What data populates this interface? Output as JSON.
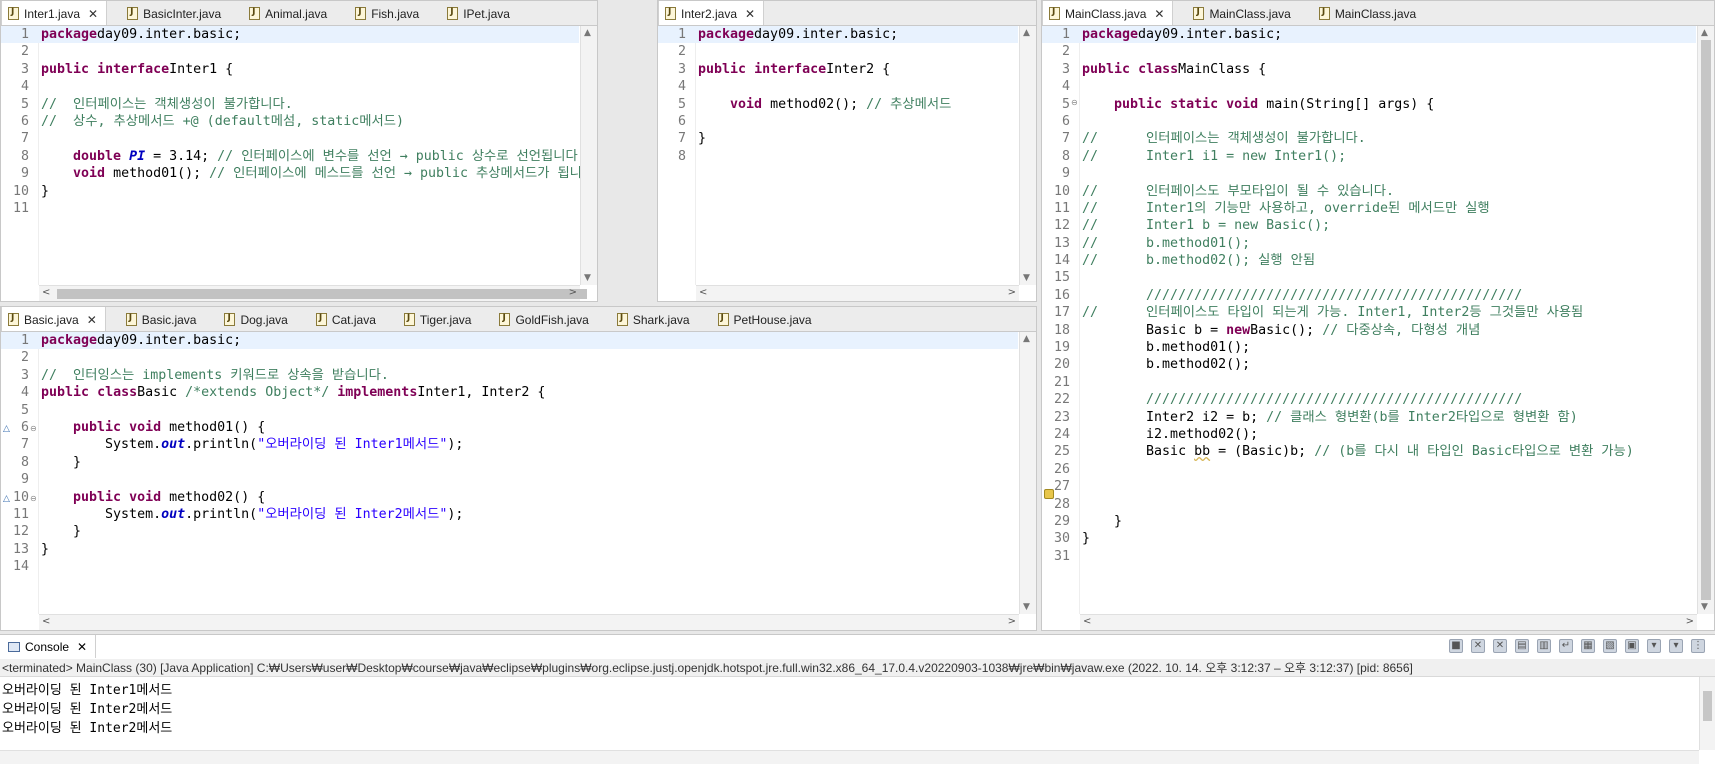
{
  "inter1_pane": {
    "tabs": [
      "Inter1.java",
      "BasicInter.java",
      "Animal.java",
      "Fish.java",
      "IPet.java"
    ],
    "lines": [
      [
        [
          "kw",
          "package"
        ],
        [
          "",
          "day09.inter.basic;"
        ]
      ],
      [],
      [
        [
          "kw",
          "public"
        ],
        [
          "",
          ""
        ],
        [
          "kw",
          "interface"
        ],
        [
          "",
          "Inter1 {"
        ]
      ],
      [],
      [
        [
          "cm",
          "//  인터페이스는 객체생성이 불가합니다."
        ]
      ],
      [
        [
          "cm",
          "//  상수, 추상메서드 +@ (default메섬, static메서드)"
        ]
      ],
      [],
      [
        [
          "",
          "    "
        ],
        [
          "kw",
          "double"
        ],
        [
          "",
          ""
        ],
        [
          "fld",
          "PI"
        ],
        [
          "",
          ""
        ],
        [
          "",
          "= 3.14; "
        ],
        [
          "cm",
          "// 인터페이스에 변수를 선언 → public 상수로 선언됩니다."
        ]
      ],
      [
        [
          "",
          "    "
        ],
        [
          "kw",
          "void"
        ],
        [
          "",
          ""
        ],
        [
          "",
          "method01(); "
        ],
        [
          "cm",
          "// 인터페이스에 메스드를 선언 → public 추상메서드가 됩니다"
        ]
      ],
      [
        [
          "",
          "}"
        ]
      ],
      []
    ]
  },
  "inter2_pane": {
    "tabs": [
      "Inter2.java"
    ],
    "lines": [
      [
        [
          "kw",
          "package"
        ],
        [
          "",
          "day09.inter.basic;"
        ]
      ],
      [],
      [
        [
          "kw",
          "public"
        ],
        [
          "",
          ""
        ],
        [
          "kw",
          "interface"
        ],
        [
          "",
          "Inter2 {"
        ]
      ],
      [],
      [
        [
          "",
          "    "
        ],
        [
          "kw",
          "void"
        ],
        [
          "",
          ""
        ],
        [
          "",
          "method02(); "
        ],
        [
          "cm",
          "// 추상메서드"
        ]
      ],
      [],
      [
        [
          "",
          "}"
        ]
      ],
      []
    ]
  },
  "basic_pane": {
    "tabs": [
      "Basic.java",
      "Basic.java",
      "Dog.java",
      "Cat.java",
      "Tiger.java",
      "GoldFish.java",
      "Shark.java",
      "PetHouse.java"
    ],
    "lines": [
      [
        [
          "kw",
          "package"
        ],
        [
          "",
          "day09.inter.basic;"
        ]
      ],
      [],
      [
        [
          "cm",
          "//  인터잉스는 implements 키워드로 상속을 받습니다."
        ]
      ],
      [
        [
          "kw",
          "public"
        ],
        [
          "",
          ""
        ],
        [
          "kw",
          "class"
        ],
        [
          "",
          "Basic "
        ],
        [
          "cm",
          "/*extends Object*/"
        ],
        [
          "",
          ""
        ],
        [
          "kw",
          "implements"
        ],
        [
          "",
          "Inter1, Inter2 {"
        ]
      ],
      [],
      [
        [
          "",
          "    "
        ],
        [
          "kw",
          "public"
        ],
        [
          "",
          ""
        ],
        [
          "kw",
          "void"
        ],
        [
          "",
          ""
        ],
        [
          "",
          "method01() {"
        ]
      ],
      [
        [
          "",
          "        System."
        ],
        [
          "fld",
          "out"
        ],
        [
          "",
          ".println("
        ],
        [
          "str",
          "\"오버라이딩 된 Inter1메서드\""
        ],
        [
          "",
          ");"
        ]
      ],
      [
        [
          "",
          "    }"
        ]
      ],
      [],
      [
        [
          "",
          "    "
        ],
        [
          "kw",
          "public"
        ],
        [
          "",
          ""
        ],
        [
          "kw",
          "void"
        ],
        [
          "",
          ""
        ],
        [
          "",
          "method02() {"
        ]
      ],
      [
        [
          "",
          "        System."
        ],
        [
          "fld",
          "out"
        ],
        [
          "",
          ".println("
        ],
        [
          "str",
          "\"오버라이딩 된 Inter2메서드\""
        ],
        [
          "",
          ");"
        ]
      ],
      [
        [
          "",
          "    }"
        ]
      ],
      [
        [
          "",
          "}"
        ]
      ],
      []
    ]
  },
  "main_pane": {
    "tabs": [
      "MainClass.java",
      "MainClass.java",
      "MainClass.java"
    ],
    "lines": [
      [
        [
          "kw",
          "package"
        ],
        [
          "",
          "day09.inter.basic;"
        ]
      ],
      [],
      [
        [
          "kw",
          "public"
        ],
        [
          "",
          ""
        ],
        [
          "kw",
          "class"
        ],
        [
          "",
          "MainClass {"
        ]
      ],
      [],
      [
        [
          "",
          "    "
        ],
        [
          "kw",
          "public"
        ],
        [
          "",
          ""
        ],
        [
          "kw",
          "static"
        ],
        [
          "",
          ""
        ],
        [
          "kw",
          "void"
        ],
        [
          "",
          ""
        ],
        [
          "",
          "main(String[] args) {"
        ]
      ],
      [],
      [
        [
          "cm",
          "//      인터페이스는 객체생성이 불가합니다."
        ]
      ],
      [
        [
          "cm",
          "//      Inter1 i1 = new Inter1();"
        ]
      ],
      [],
      [
        [
          "cm",
          "//      인터페이스도 부모타입이 될 수 있습니다."
        ]
      ],
      [
        [
          "cm",
          "//      Inter1의 기능만 사용하고, override된 메서드만 실행"
        ]
      ],
      [
        [
          "cm",
          "//      Inter1 b = new Basic();"
        ]
      ],
      [
        [
          "cm",
          "//      b.method01();"
        ]
      ],
      [
        [
          "cm",
          "//      b.method02(); 실행 안됨"
        ]
      ],
      [],
      [
        [
          "cm",
          "        ///////////////////////////////////////////////"
        ]
      ],
      [
        [
          "cm",
          "//      인터페이스도 타입이 되는게 가능. Inter1, Inter2등 그것들만 사용됨"
        ]
      ],
      [
        [
          "",
          "        Basic b = "
        ],
        [
          "kw",
          "new"
        ],
        [
          "",
          "Basic(); "
        ],
        [
          "cm",
          "// 다중상속, 다형성 개념"
        ]
      ],
      [
        [
          "",
          "        b.method01();"
        ]
      ],
      [
        [
          "",
          "        b.method02();"
        ]
      ],
      [],
      [
        [
          "cm",
          "        ///////////////////////////////////////////////"
        ]
      ],
      [
        [
          "",
          "        Inter2 i2 = b; "
        ],
        [
          "cm",
          "// 클래스 형변환(b를 Inter2타입으로 형변환 함)"
        ]
      ],
      [
        [
          "",
          "        i2.method02();"
        ]
      ],
      [
        [
          "",
          "        Basic "
        ],
        [
          "un",
          "bb"
        ],
        [
          "",
          ""
        ],
        [
          "",
          "= (Basic)b; "
        ],
        [
          "cm",
          "// (b를 다시 내 타입인 Basic타입으로 변환 가능)"
        ]
      ],
      [],
      [],
      [],
      [
        [
          "",
          "    }"
        ]
      ],
      [
        [
          "",
          "}"
        ]
      ],
      []
    ]
  },
  "console": {
    "tab_label": "Console",
    "status": "<terminated> MainClass (30) [Java Application] C:₩Users₩user₩Desktop₩course₩java₩eclipse₩plugins₩org.eclipse.justj.openjdk.hotspot.jre.full.win32.x86_64_17.0.4.v20220903-1038₩jre₩bin₩javaw.exe  (2022. 10. 14. 오후 3:12:37 – 오후 3:12:37) [pid: 8656]",
    "output": [
      "오버라이딩 된 Inter1메서드",
      "오버라이딩 된 Inter2메서드",
      "오버라이딩 된 Inter2메서드"
    ]
  }
}
